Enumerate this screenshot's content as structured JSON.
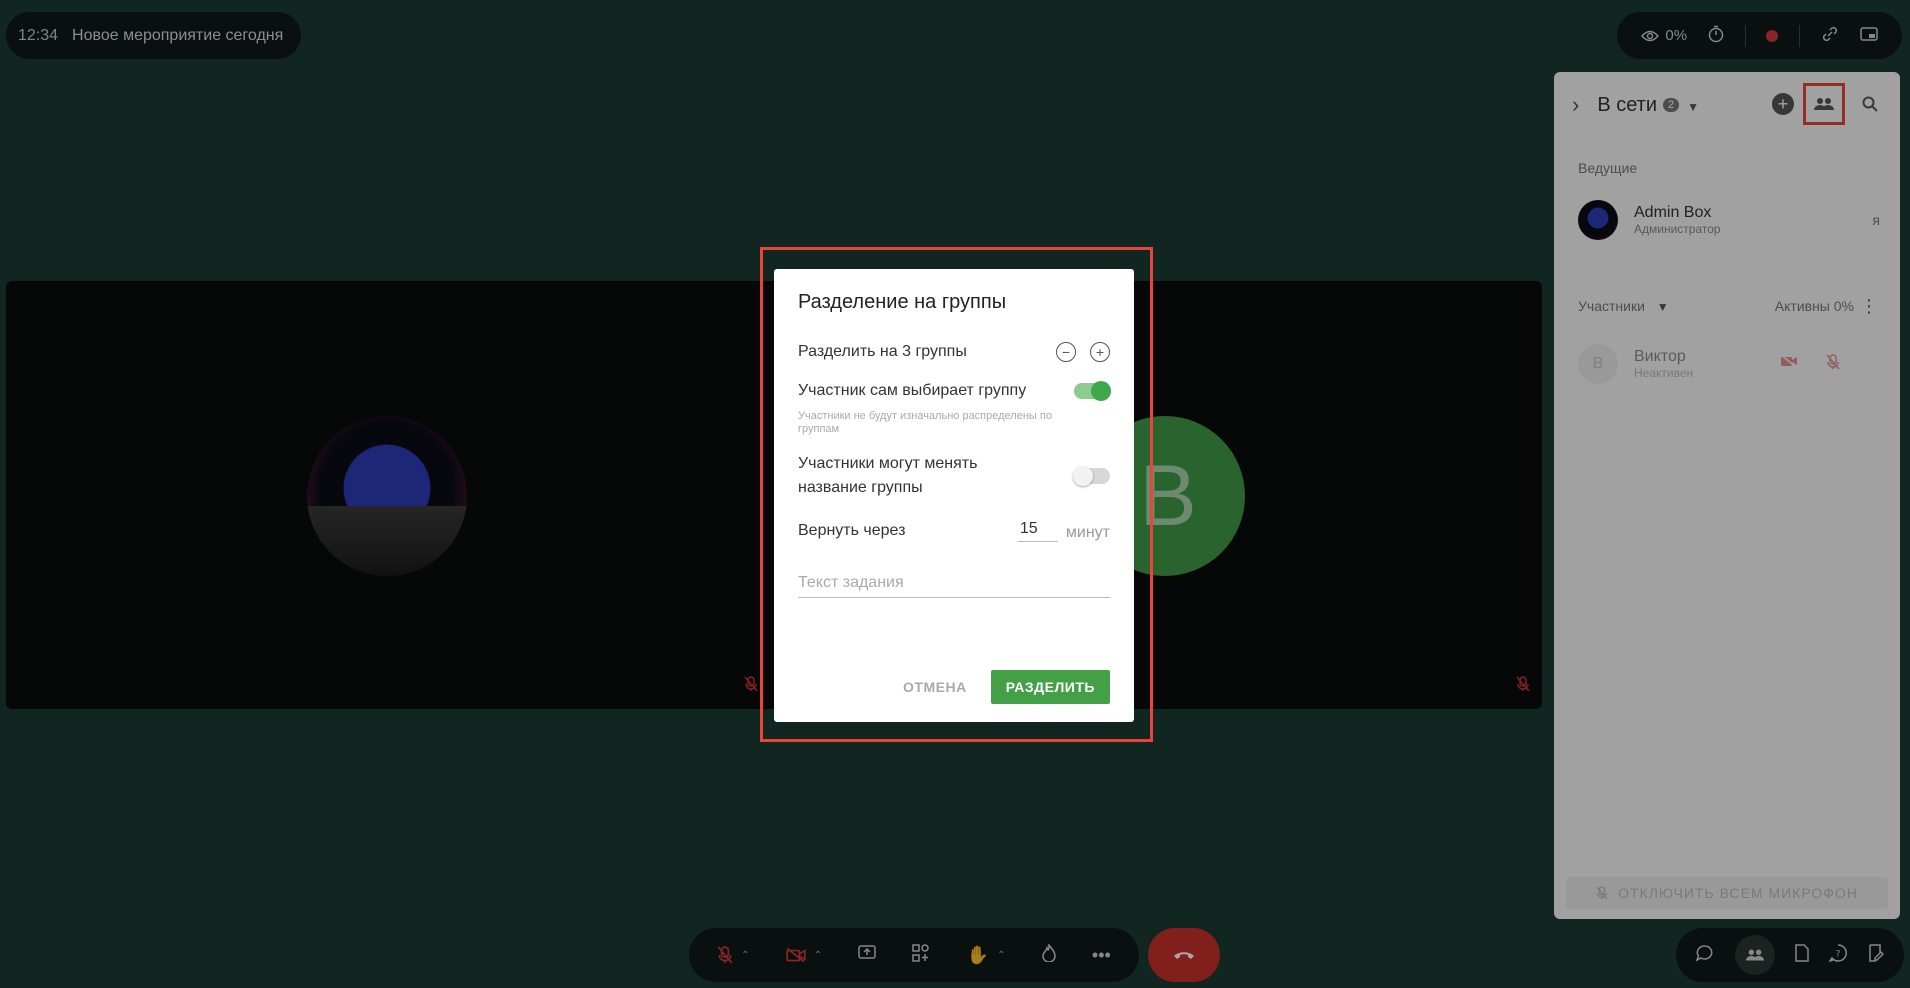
{
  "top_bar": {
    "time": "12:34",
    "event_title": "Новое мероприятие сегодня"
  },
  "top_tools": {
    "views_percent": "0%"
  },
  "tiles": {
    "user_b_initial": "В"
  },
  "panel": {
    "title": "В сети",
    "online_count": "2",
    "hosts_label": "Ведущие",
    "host": {
      "name": "Admin Box",
      "role": "Администратор",
      "me_label": "я"
    },
    "participants_label": "Участники",
    "active_label": "Активны 0%",
    "user": {
      "initial": "В",
      "name": "Виктор",
      "status": "Неактивен"
    },
    "mute_all_label": "ОТКЛЮЧИТЬ ВСЕМ МИКРОФОН"
  },
  "modal": {
    "title": "Разделение на группы",
    "split_label": "Разделить на 3 группы",
    "self_select_label": "Участник сам выбирает группу",
    "self_select_on": true,
    "self_select_hint": "Участники не будут изначально распределены по группам",
    "rename_label": "Участники могут менять название группы",
    "rename_on": false,
    "return_label": "Вернуть через",
    "return_value": "15",
    "return_unit": "минут",
    "task_placeholder": "Текст задания",
    "cancel_label": "ОТМЕНА",
    "split_button_label": "РАЗДЕЛИТЬ"
  },
  "colors": {
    "accent": "#43a047",
    "danger": "#d23b3b",
    "highlight": "#e8453c",
    "background": "#1b3a33"
  }
}
